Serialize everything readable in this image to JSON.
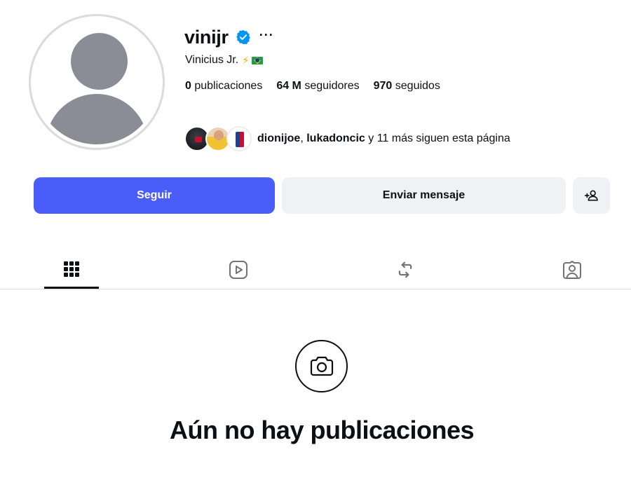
{
  "profile": {
    "username": "vinijr",
    "more_label": "···",
    "full_name": "Vinicius Jr.",
    "name_emoji": "⚡",
    "stats": {
      "posts_count": "0",
      "posts_label": "publicaciones",
      "followers_count": "64 M",
      "followers_label": "seguidores",
      "following_count": "970",
      "following_label": "seguidos"
    },
    "followed_by": {
      "user1": "dionijoe",
      "separator": ", ",
      "user2": "lukadoncic",
      "suffix": " y 11 más siguen esta página"
    }
  },
  "actions": {
    "follow_label": "Seguir",
    "message_label": "Enviar mensaje"
  },
  "tabs": [
    {
      "name": "posts",
      "icon": "grid-icon",
      "active": true
    },
    {
      "name": "reels",
      "icon": "reels-icon",
      "active": false
    },
    {
      "name": "reposts",
      "icon": "repost-icon",
      "active": false
    },
    {
      "name": "tagged",
      "icon": "tagged-icon",
      "active": false
    }
  ],
  "empty_state": {
    "icon": "camera-icon",
    "title": "Aún no hay publicaciones"
  },
  "colors": {
    "accent": "#4a5df9",
    "verified": "#0095f6",
    "text": "#0c1014",
    "secondary_bg": "#eff1f4"
  }
}
